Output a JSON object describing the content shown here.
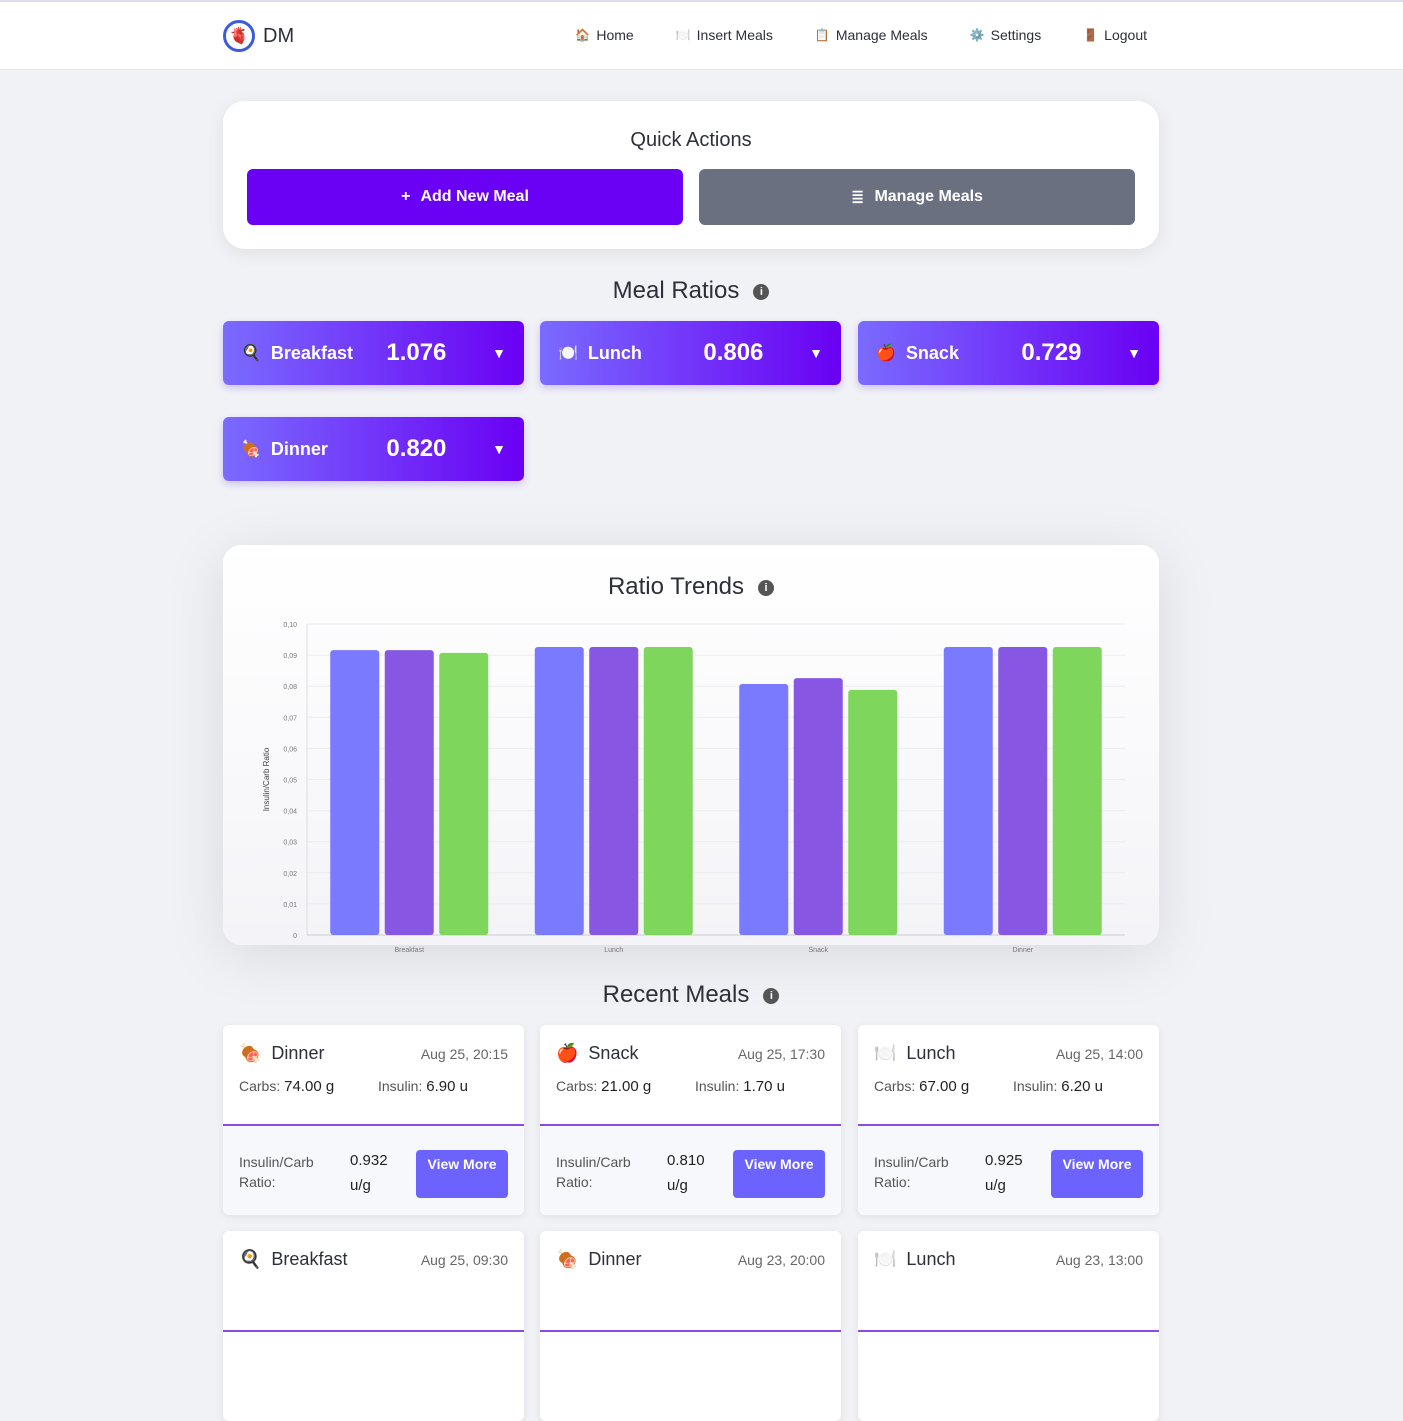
{
  "nav": {
    "logo_text": "DM",
    "links": [
      {
        "icon": "🏠",
        "label": "Home"
      },
      {
        "icon": "🍽️",
        "label": "Insert Meals"
      },
      {
        "icon": "📋",
        "label": "Manage Meals"
      },
      {
        "icon": "⚙️",
        "label": "Settings"
      },
      {
        "icon": "🚪",
        "label": "Logout"
      }
    ]
  },
  "quick_actions": {
    "title": "Quick Actions",
    "add_label": "Add New Meal",
    "manage_label": "Manage Meals",
    "add_color": "#6a00f4",
    "manage_color": "#6b7080"
  },
  "meal_ratios": {
    "title": "Meal Ratios",
    "items": [
      {
        "icon": "🍳",
        "name": "Breakfast",
        "value": "1.076"
      },
      {
        "icon": "🍽️",
        "name": "Lunch",
        "value": "0.806"
      },
      {
        "icon": "🍎",
        "name": "Snack",
        "value": "0.729"
      },
      {
        "icon": "🍖",
        "name": "Dinner",
        "value": "0.820"
      }
    ]
  },
  "ratio_trends": {
    "title": "Ratio Trends"
  },
  "chart_data": {
    "type": "bar",
    "categories": [
      "Breakfast",
      "Lunch",
      "Snack",
      "Dinner"
    ],
    "ylabel": "Insulin/Carb Ratio",
    "ylim": [
      0,
      0.1
    ],
    "yticks": [
      "0",
      "0,01",
      "0,02",
      "0,03",
      "0,04",
      "0,05",
      "0,06",
      "0,07",
      "0,08",
      "0,09",
      "0,10"
    ],
    "grid": true,
    "series": [
      {
        "color": "#7a7aff",
        "values": [
          0.0916,
          0.0926,
          0.0807,
          0.0926
        ]
      },
      {
        "color": "#8757e4",
        "values": [
          0.0916,
          0.0926,
          0.0826,
          0.0926
        ]
      },
      {
        "color": "#7fd65c",
        "values": [
          0.0907,
          0.0926,
          0.0788,
          0.0926
        ]
      }
    ]
  },
  "recent_meals": {
    "title": "Recent Meals",
    "carbs_label": "Carbs:",
    "insulin_label": "Insulin:",
    "ratio_label": "Insulin/Carb Ratio:",
    "view_label": "View More",
    "items": [
      {
        "icon": "🍖",
        "name": "Dinner",
        "date": "Aug 25, 20:15",
        "carbs": "74.00 g",
        "insulin": "6.90 u",
        "ratio": "0.932 u/g"
      },
      {
        "icon": "🍎",
        "name": "Snack",
        "date": "Aug 25, 17:30",
        "carbs": "21.00 g",
        "insulin": "1.70 u",
        "ratio": "0.810 u/g"
      },
      {
        "icon": "🍽️",
        "name": "Lunch",
        "date": "Aug 25, 14:00",
        "carbs": "67.00 g",
        "insulin": "6.20 u",
        "ratio": "0.925 u/g"
      },
      {
        "icon": "🍳",
        "name": "Breakfast",
        "date": "Aug 25, 09:30"
      },
      {
        "icon": "🍖",
        "name": "Dinner",
        "date": "Aug 23, 20:00"
      },
      {
        "icon": "🍽️",
        "name": "Lunch",
        "date": "Aug 23, 13:00"
      }
    ]
  }
}
